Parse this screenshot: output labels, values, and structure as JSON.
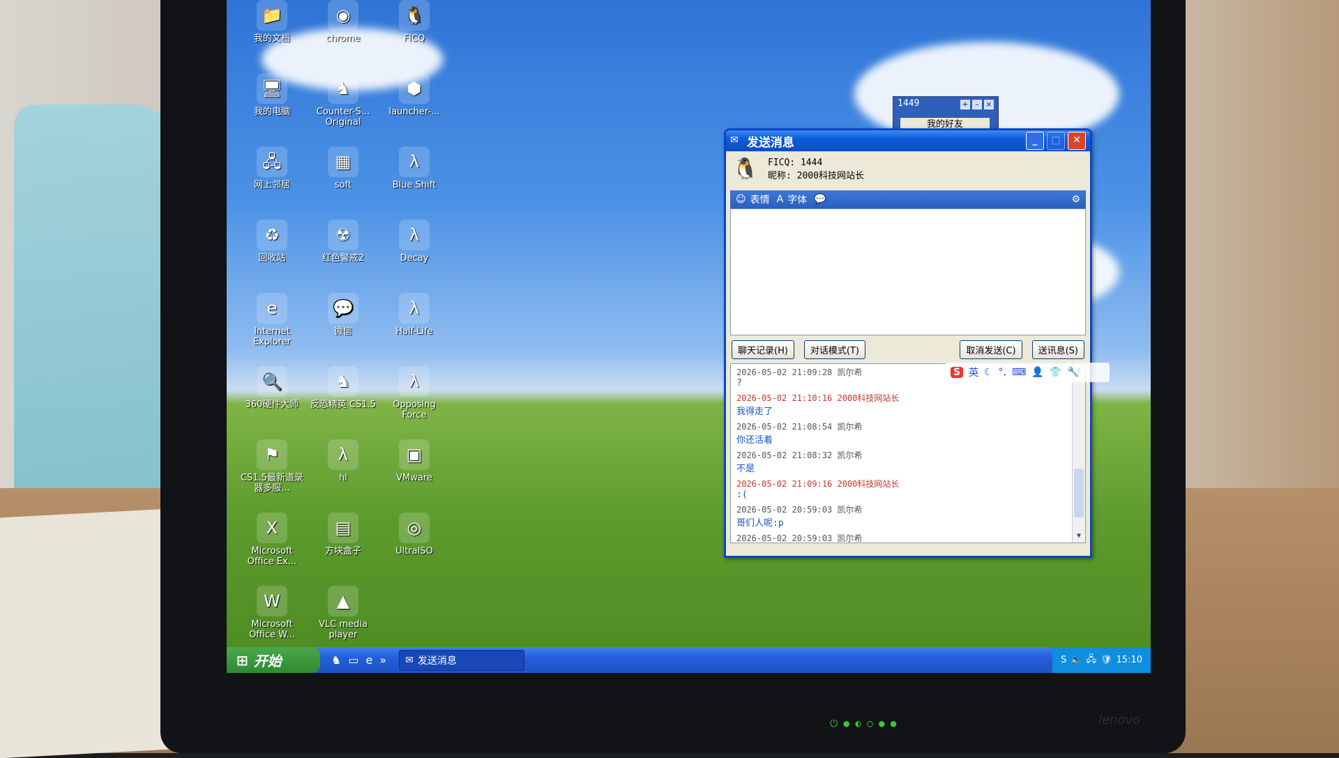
{
  "desktop_icons": [
    {
      "id": "my-documents",
      "label": "我的文档",
      "glyph": "📁"
    },
    {
      "id": "chrome",
      "label": "chrome",
      "glyph": "◉"
    },
    {
      "id": "ficq",
      "label": "FICQ",
      "glyph": "🐧"
    },
    {
      "id": "my-computer",
      "label": "我的电脑",
      "glyph": "🖥"
    },
    {
      "id": "counter-strike",
      "label": "Counter-S... Original",
      "glyph": "♞"
    },
    {
      "id": "launcher",
      "label": "launcher-...",
      "glyph": "⬢"
    },
    {
      "id": "network",
      "label": "网上邻居",
      "glyph": "🖧"
    },
    {
      "id": "soft",
      "label": "soft",
      "glyph": "▦"
    },
    {
      "id": "blue-shift",
      "label": "Blue Shift",
      "glyph": "λ"
    },
    {
      "id": "recycle-bin",
      "label": "回收站",
      "glyph": "♻"
    },
    {
      "id": "red-alert",
      "label": "红色警戒2",
      "glyph": "☢"
    },
    {
      "id": "decay",
      "label": "Decay",
      "glyph": "λ"
    },
    {
      "id": "internet-explorer",
      "label": "Internet Explorer",
      "glyph": "e"
    },
    {
      "id": "wechat",
      "label": "微信",
      "glyph": "💬"
    },
    {
      "id": "half-life",
      "label": "Half-Life",
      "glyph": "λ"
    },
    {
      "id": "hardware-master",
      "label": "360硬件大师",
      "glyph": "🔍"
    },
    {
      "id": "cs15",
      "label": "反恐精英 CS1.5",
      "glyph": "♞"
    },
    {
      "id": "opposing-force",
      "label": "Opposing Force",
      "glyph": "λ"
    },
    {
      "id": "cs15-recorder",
      "label": "CS1.5最新道录器多服...",
      "glyph": "⚑"
    },
    {
      "id": "hl",
      "label": "hl",
      "glyph": "λ"
    },
    {
      "id": "vmware",
      "label": "VMware",
      "glyph": "▣"
    },
    {
      "id": "ms-excel",
      "label": "Microsoft Office Ex...",
      "glyph": "X"
    },
    {
      "id": "minecraft-box",
      "label": "方块盒子",
      "glyph": "▤"
    },
    {
      "id": "ultraiso",
      "label": "UltraISO",
      "glyph": "◎"
    },
    {
      "id": "ms-word",
      "label": "Microsoft Office W...",
      "glyph": "W"
    },
    {
      "id": "vlc",
      "label": "VLC media player",
      "glyph": "▲"
    }
  ],
  "buddy_window": {
    "title": "1449",
    "tab": "我的好友"
  },
  "send_window": {
    "title": "发送消息",
    "ficq_label": "FICQ: 1444",
    "nickname_label": "昵称: 2000科技网站长",
    "toolbar": {
      "emoji": "表情",
      "font": "字体"
    },
    "buttons": {
      "history": "聊天记录(H)",
      "dialog_mode": "对话模式(T)",
      "cancel": "取消发送(C)",
      "send": "送讯息(S)"
    },
    "messages": [
      {
        "meta": "2026-05-02 21:09:28  凯尔希",
        "body": "?",
        "self": false
      },
      {
        "meta": "2026-05-02 21:10:16  2000科技网站长",
        "body": "我得走了",
        "self": true
      },
      {
        "meta": "2026-05-02 21:08:54  凯尔希",
        "body": "你还活着",
        "self": false
      },
      {
        "meta": "2026-05-02 21:08:32  凯尔希",
        "body": "不是",
        "self": false
      },
      {
        "meta": "2026-05-02 21:09:16  2000科技网站长",
        "body": ":(",
        "self": true
      },
      {
        "meta": "2026-05-02 20:59:03  凯尔希",
        "body": "哥们人呢:p",
        "self": false
      },
      {
        "meta": "2026-05-02 20:59:03  凯尔希",
        "body": "",
        "self": false
      }
    ]
  },
  "ime": {
    "lang": "英"
  },
  "taskbar": {
    "start": "开始",
    "task": "发送消息",
    "clock": "15:10"
  },
  "bezel": {
    "brand": "lenovo"
  }
}
